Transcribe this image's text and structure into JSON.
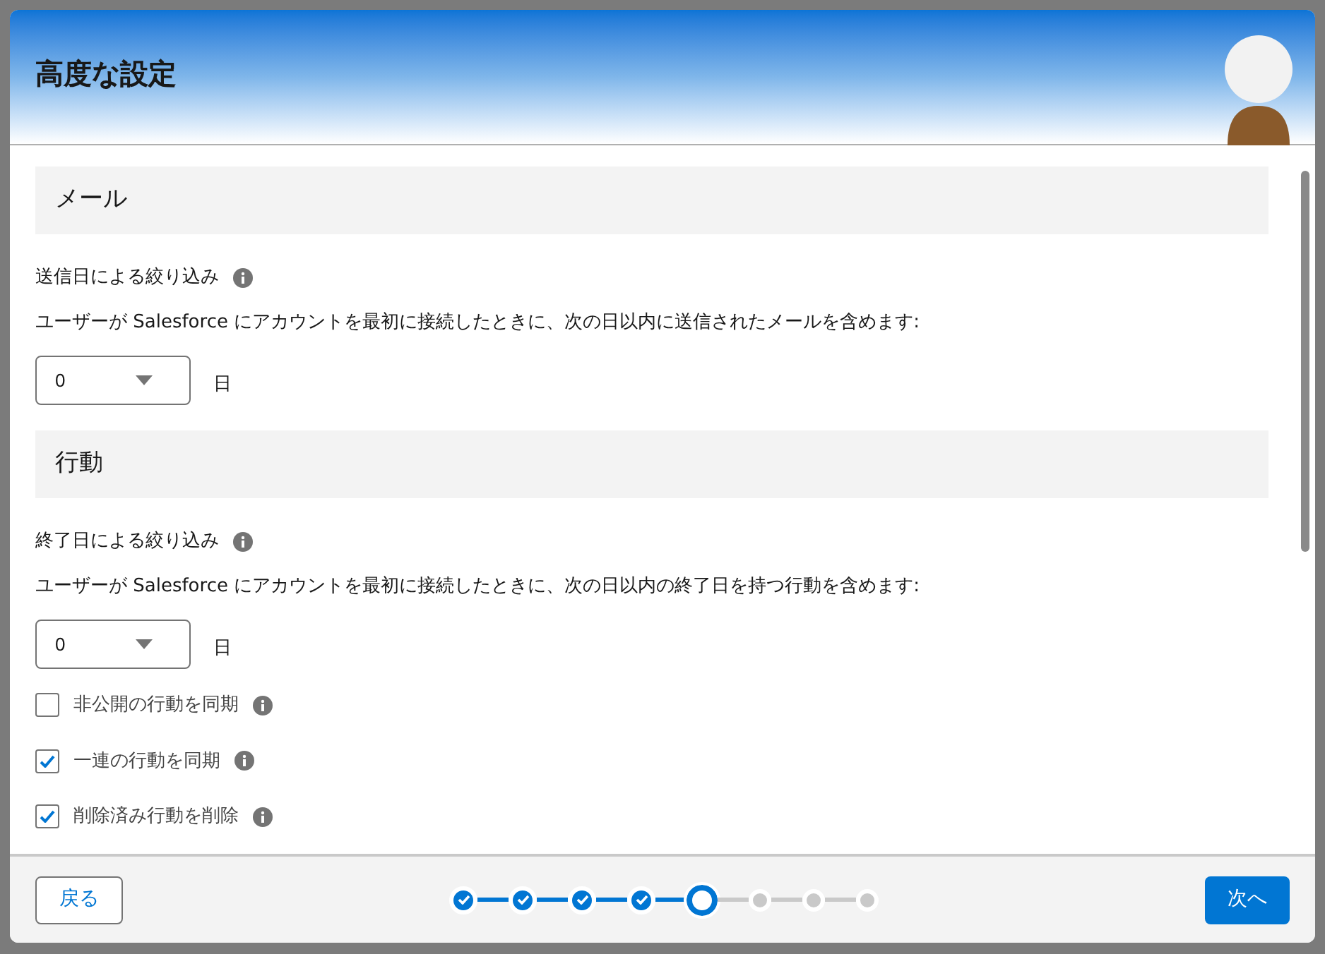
{
  "modal": {
    "title": "高度な設定"
  },
  "sections": [
    {
      "heading": "メール",
      "filter_label": "送信日による絞り込み",
      "description": "ユーザーが Salesforce にアカウントを最初に接続したときに、次の日以内に送信されたメールを含めます:",
      "days_value": "0",
      "days_unit": "日"
    },
    {
      "heading": "行動",
      "filter_label": "終了日による絞り込み",
      "description": "ユーザーが Salesforce にアカウントを最初に接続したときに、次の日以内の終了日を持つ行動を含めます:",
      "days_value": "0",
      "days_unit": "日",
      "checkboxes": [
        {
          "label": "非公開の行動を同期",
          "checked": false
        },
        {
          "label": "一連の行動を同期",
          "checked": true
        },
        {
          "label": "削除済み行動を削除",
          "checked": true
        }
      ]
    }
  ],
  "footer": {
    "back_button": "戻る",
    "next_button": "次へ",
    "steps": [
      {
        "kind": "done"
      },
      {
        "kind": "done"
      },
      {
        "kind": "done"
      },
      {
        "kind": "done"
      },
      {
        "kind": "current"
      },
      {
        "kind": "todo"
      },
      {
        "kind": "todo"
      },
      {
        "kind": "todo"
      }
    ]
  }
}
